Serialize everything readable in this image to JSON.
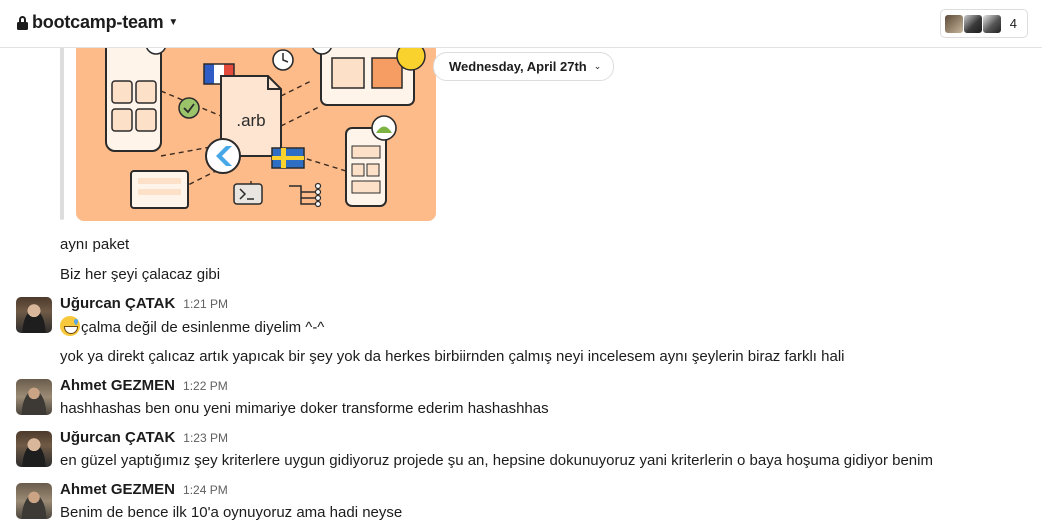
{
  "header": {
    "channel_name": "bootcamp-team",
    "member_count": "4"
  },
  "date_divider": {
    "label": "Wednesday, April 27th"
  },
  "illustration": {
    "file_label": ".arb"
  },
  "continued_messages": [
    {
      "text": "aynı paket"
    },
    {
      "text": "Biz her şeyi çalacaz gibi"
    }
  ],
  "messages": [
    {
      "sender": "Uğurcan ÇATAK",
      "time": "1:21 PM",
      "text": "çalma değil de esinlenme diyelim ^-^",
      "emoji": "sweat-smile-icon",
      "followup": "yok ya direkt çalıcaz artık yapıcak bir şey yok da herkes birbiirnden çalmış neyi incelesem aynı şeylerin biraz farklı hali"
    },
    {
      "sender": "Ahmet GEZMEN",
      "time": "1:22 PM",
      "text": "hashhashas ben onu yeni mimariye doker transforme ederim hashashhas"
    },
    {
      "sender": "Uğurcan ÇATAK",
      "time": "1:23 PM",
      "text": "en güzel yaptığımız şey kriterlere uygun gidiyoruz projede şu an, hepsine dokunuyoruz yani kriterlerin o baya hoşuma gidiyor benim"
    },
    {
      "sender": "Ahmet GEZMEN",
      "time": "1:24 PM",
      "text": "Benim de bence ilk 10'a oynuyoruz ama hadi neyse"
    }
  ],
  "colors": {
    "illustration_bg": "#fdbb8a",
    "text": "#1d1c1d",
    "timestamp": "#616061",
    "border": "#dddddd"
  }
}
